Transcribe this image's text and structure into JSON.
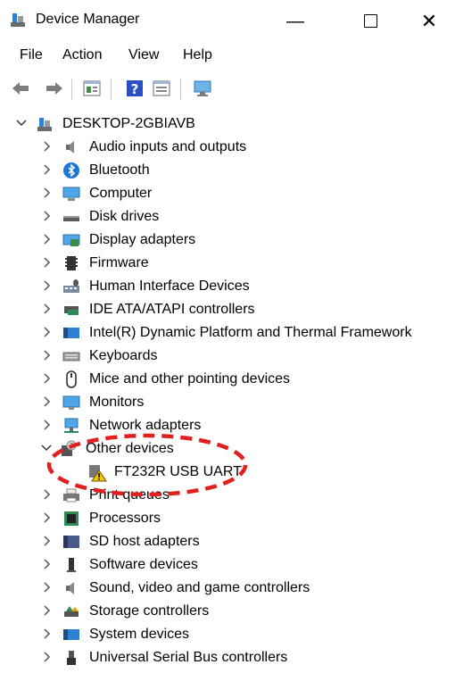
{
  "window": {
    "title": "Device Manager",
    "min_glyph": "—",
    "close_glyph": "✕"
  },
  "menu": [
    "File",
    "Action",
    "View",
    "Help"
  ],
  "tree": {
    "root": "DESKTOP-2GBIAVB",
    "categories": [
      {
        "label": "Audio inputs and outputs",
        "icon": "speaker-icon",
        "expanded": false
      },
      {
        "label": "Bluetooth",
        "icon": "bluetooth-icon",
        "expanded": false
      },
      {
        "label": "Computer",
        "icon": "computer-icon",
        "expanded": false
      },
      {
        "label": "Disk drives",
        "icon": "disk-drive-icon",
        "expanded": false
      },
      {
        "label": "Display adapters",
        "icon": "display-adapter-icon",
        "expanded": false
      },
      {
        "label": "Firmware",
        "icon": "firmware-icon",
        "expanded": false
      },
      {
        "label": "Human Interface Devices",
        "icon": "hid-icon",
        "expanded": false
      },
      {
        "label": "IDE ATA/ATAPI controllers",
        "icon": "ide-controller-icon",
        "expanded": false
      },
      {
        "label": "Intel(R) Dynamic Platform and Thermal Framework",
        "icon": "thermal-framework-icon",
        "expanded": false
      },
      {
        "label": "Keyboards",
        "icon": "keyboard-icon",
        "expanded": false
      },
      {
        "label": "Mice and other pointing devices",
        "icon": "mouse-icon",
        "expanded": false
      },
      {
        "label": "Monitors",
        "icon": "monitor-icon",
        "expanded": false
      },
      {
        "label": "Network adapters",
        "icon": "network-adapter-icon",
        "expanded": false
      },
      {
        "label": "Other devices",
        "icon": "other-devices-icon",
        "expanded": true,
        "children": [
          {
            "label": "FT232R USB UART",
            "icon": "warning-device-icon"
          }
        ]
      },
      {
        "label": "Print queues",
        "icon": "printer-icon",
        "expanded": false
      },
      {
        "label": "Processors",
        "icon": "processor-icon",
        "expanded": false
      },
      {
        "label": "SD host adapters",
        "icon": "sd-adapter-icon",
        "expanded": false
      },
      {
        "label": "Software devices",
        "icon": "software-device-icon",
        "expanded": false
      },
      {
        "label": "Sound, video and game controllers",
        "icon": "sound-controller-icon",
        "expanded": false
      },
      {
        "label": "Storage controllers",
        "icon": "storage-controller-icon",
        "expanded": false
      },
      {
        "label": "System devices",
        "icon": "system-devices-icon",
        "expanded": false
      },
      {
        "label": "Universal Serial Bus controllers",
        "icon": "usb-icon",
        "expanded": false
      }
    ]
  },
  "colors": {
    "annotation": "#e0201e",
    "warning": "#f5c400"
  }
}
